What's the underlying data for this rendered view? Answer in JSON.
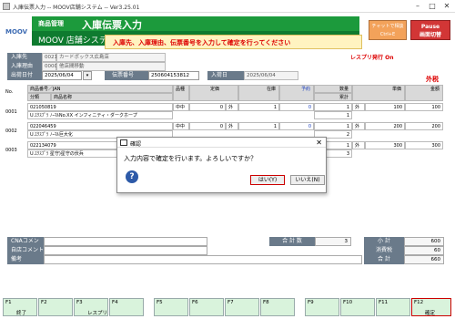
{
  "window": {
    "title": "入庫伝票入力 -- MOOV店舗システム -- Ver3.25.01"
  },
  "header": {
    "logo": "MOOV",
    "category": "商品管理",
    "title": "入庫伝票入力",
    "system_name": "MOOV 店舗システム",
    "message": "入庫先、入庫理由、伝票番号を入力して確定を行ってください",
    "chat_button": "チャットで相談\nCtrl+E",
    "pause_button": "Pause\n画面切替"
  },
  "form": {
    "warehouse_label": "入庫先",
    "warehouse_code": "0021",
    "warehouse_name": "カードボックス広島店",
    "reason_label": "入庫理由",
    "reason_code": "00002",
    "reason_name": "他店間移動",
    "ship_date_label": "出荷日付",
    "ship_date": "2025/06/04",
    "slip_label": "伝票番号",
    "slip_no": "250604153812",
    "arrival_label": "入荷日",
    "arrival_date": "2025/06/04",
    "reprint": "レスプリ発行 On",
    "outsale": "外税"
  },
  "table": {
    "headers": {
      "no": "No.",
      "code": "商品番号／JAN",
      "category": "分類",
      "name": "商品名称",
      "grade": "品種",
      "fixed_price": "定価",
      "stock": "在庫",
      "reserve": "予約",
      "qty": "数量",
      "cumulative": "累計",
      "unit_price": "単価",
      "amount": "金額"
    },
    "rows": [
      {
        "no": "0001",
        "code": "021050819",
        "category": "U.ｴｸｽﾌﾟﾗ",
        "name": "ﾉｰﾏﾙNo.XX インフィニティ・ダークホープ",
        "grade": "中中",
        "price": "0",
        "tax": "外",
        "stock": "1",
        "reserve": "0",
        "qty": "1",
        "cum": "1",
        "taxb": "外",
        "unit": "100",
        "amount": "100"
      },
      {
        "no": "0002",
        "code": "022046459",
        "category": "U.ｴｸｽﾌﾟﾗ",
        "name": "ﾉｰﾏﾙ巨大化",
        "grade": "中中",
        "price": "0",
        "tax": "外",
        "stock": "1",
        "reserve": "0",
        "qty": "1",
        "cum": "2",
        "taxb": "外",
        "unit": "200",
        "amount": "200"
      },
      {
        "no": "0003",
        "code": "022134079",
        "category": "U.ｴｸｽﾌﾟﾗ",
        "name": "星守)星守の伏兵",
        "grade": "中中",
        "price": "0",
        "tax": "外",
        "stock": "1",
        "reserve": "0",
        "qty": "1",
        "cum": "3",
        "taxb": "外",
        "unit": "300",
        "amount": "300"
      }
    ]
  },
  "footer": {
    "cna_label": "CNAコメント",
    "store_label": "自店コメント",
    "note_label": "備考",
    "total_label": "合 計 数",
    "total_qty": "3",
    "subtotal_label": "小 計",
    "subtotal": "600",
    "tax_label": "消費税",
    "tax": "60",
    "sum_label": "合 計",
    "sum": "660"
  },
  "fkeys": [
    {
      "key": "F1",
      "label": "終了"
    },
    {
      "key": "F2",
      "label": ""
    },
    {
      "key": "F3",
      "label": "レスプリ"
    },
    {
      "key": "F4",
      "label": ""
    },
    {
      "key": "F5",
      "label": ""
    },
    {
      "key": "F6",
      "label": ""
    },
    {
      "key": "F7",
      "label": ""
    },
    {
      "key": "F8",
      "label": ""
    },
    {
      "key": "F9",
      "label": ""
    },
    {
      "key": "F10",
      "label": ""
    },
    {
      "key": "F11",
      "label": ""
    },
    {
      "key": "F12",
      "label": "確定"
    }
  ],
  "dialog": {
    "title": "確認",
    "message": "入力内容で確定を行います。よろしいですか？",
    "yes": "はい(Y)",
    "no": "いいえ(N)"
  }
}
